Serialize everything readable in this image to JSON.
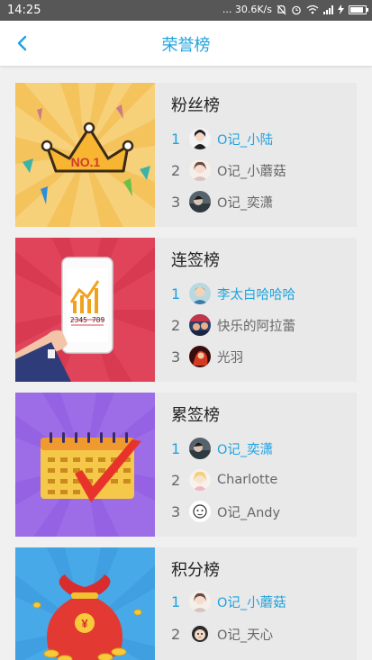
{
  "status_bar": {
    "time": "14:25",
    "network_speed": "... 30.6K/s",
    "battery_level": 0.85
  },
  "nav": {
    "title": "荣誉榜"
  },
  "boards": [
    {
      "title": "粉丝榜",
      "badge_text": "NO.1",
      "entries": [
        {
          "rank": "1",
          "name": "O记_小陆"
        },
        {
          "rank": "2",
          "name": "O记_小蘑菇"
        },
        {
          "rank": "3",
          "name": "O记_奕潇"
        }
      ]
    },
    {
      "title": "连签榜",
      "phone_text": "2345 789",
      "entries": [
        {
          "rank": "1",
          "name": "李太白哈哈哈"
        },
        {
          "rank": "2",
          "name": "快乐的阿拉蕾"
        },
        {
          "rank": "3",
          "name": "光羽"
        }
      ]
    },
    {
      "title": "累签榜",
      "entries": [
        {
          "rank": "1",
          "name": "O记_奕潇"
        },
        {
          "rank": "2",
          "name": "Charlotte"
        },
        {
          "rank": "3",
          "name": "O记_Andy"
        }
      ]
    },
    {
      "title": "积分榜",
      "bag_symbol": "¥",
      "entries": [
        {
          "rank": "1",
          "name": "O记_小蘑菇"
        },
        {
          "rank": "2",
          "name": "O记_天心"
        }
      ]
    }
  ],
  "colors": {
    "accent": "#1fa3e0",
    "text": "#666666"
  }
}
